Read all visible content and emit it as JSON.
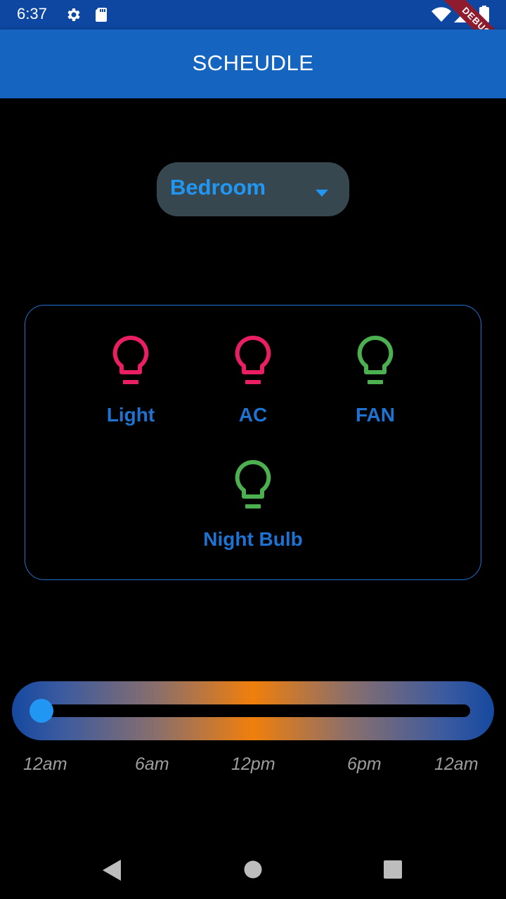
{
  "status_bar": {
    "time": "6:37",
    "icons": [
      "gear-icon",
      "sd-card-icon",
      "wifi-icon",
      "signal-icon",
      "battery-icon"
    ],
    "debug_banner": "DEBUG"
  },
  "app_bar": {
    "title": "SCHEUDLE",
    "color": "#1565c0"
  },
  "room_dropdown": {
    "selected": "Bedroom",
    "caret_icon": "arrow-drop-down-icon"
  },
  "devices": [
    {
      "label": "Light",
      "icon": "lightbulb-outline-icon",
      "color": "#e91e63"
    },
    {
      "label": "AC",
      "icon": "lightbulb-outline-icon",
      "color": "#e91e63"
    },
    {
      "label": "FAN",
      "icon": "lightbulb-outline-icon",
      "color": "#4caf50"
    },
    {
      "label": "Night Bulb",
      "icon": "lightbulb-outline-icon",
      "color": "#4caf50"
    }
  ],
  "time_slider": {
    "value_fraction": 0.0,
    "tick_labels": [
      "12am",
      "6am",
      "12pm",
      "6pm",
      "12am"
    ]
  },
  "nav_bar": {
    "icons": [
      "back-icon",
      "home-icon",
      "recents-icon"
    ]
  },
  "colors": {
    "accent": "#2196f3",
    "on_state": "#4caf50",
    "off_state": "#e91e63",
    "label_blue": "#1e73d2"
  }
}
